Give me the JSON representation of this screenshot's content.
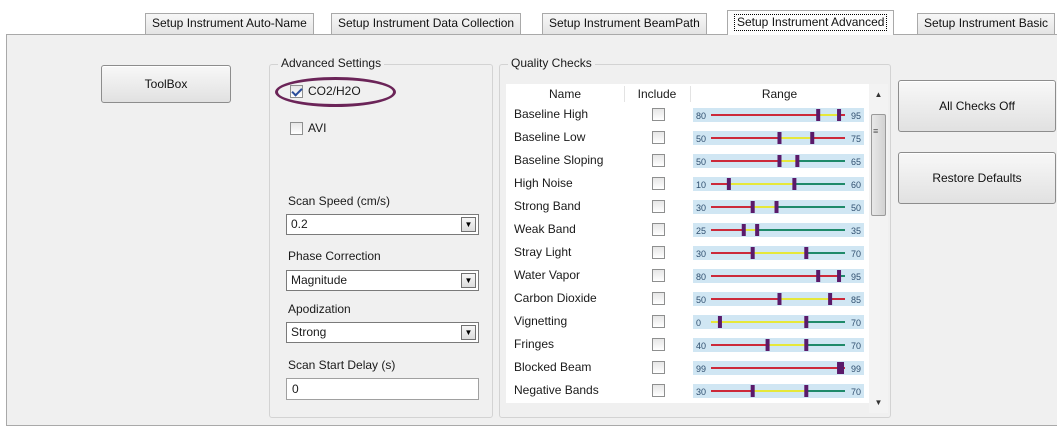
{
  "tabs": [
    {
      "label": "Setup Instrument Auto-Name",
      "active": false
    },
    {
      "label": "Setup Instrument Data Collection",
      "active": false
    },
    {
      "label": "Setup Instrument BeamPath",
      "active": false
    },
    {
      "label": "Setup Instrument Advanced",
      "active": true
    },
    {
      "label": "Setup Instrument Basic",
      "active": false
    }
  ],
  "toolbox_button": "ToolBox",
  "advanced": {
    "title": "Advanced Settings",
    "co2_h2o": {
      "label": "CO2/H2O",
      "checked": true
    },
    "avi": {
      "label": "AVI",
      "checked": false
    },
    "scan_speed_label": "Scan Speed (cm/s)",
    "scan_speed_value": "0.2",
    "phase_correction_label": "Phase Correction",
    "phase_correction_value": "Magnitude",
    "apodization_label": "Apodization",
    "apodization_value": "Strong",
    "scan_start_delay_label": "Scan Start Delay (s)",
    "scan_start_delay_value": "0"
  },
  "quality": {
    "title": "Quality Checks",
    "columns": {
      "name": "Name",
      "include": "Include",
      "range": "Range"
    },
    "rows": [
      {
        "name": "Baseline High",
        "include": false,
        "min": "80",
        "max": "95",
        "lo": 0.72,
        "hi": 0.86,
        "scheme": "ryr"
      },
      {
        "name": "Baseline Low",
        "include": false,
        "min": "50",
        "max": "75",
        "lo": 0.46,
        "hi": 0.68,
        "scheme": "ryr"
      },
      {
        "name": "Baseline Sloping",
        "include": false,
        "min": "50",
        "max": "65",
        "lo": 0.46,
        "hi": 0.58,
        "scheme": "ryg"
      },
      {
        "name": "High Noise",
        "include": false,
        "min": "10",
        "max": "60",
        "lo": 0.12,
        "hi": 0.56,
        "scheme": "ryg"
      },
      {
        "name": "Strong Band",
        "include": false,
        "min": "30",
        "max": "50",
        "lo": 0.28,
        "hi": 0.44,
        "scheme": "ryg"
      },
      {
        "name": "Weak Band",
        "include": false,
        "min": "25",
        "max": "35",
        "lo": 0.22,
        "hi": 0.31,
        "scheme": "ryg"
      },
      {
        "name": "Stray Light",
        "include": false,
        "min": "30",
        "max": "70",
        "lo": 0.28,
        "hi": 0.64,
        "scheme": "ryg"
      },
      {
        "name": "Water Vapor",
        "include": false,
        "min": "80",
        "max": "95",
        "lo": 0.72,
        "hi": 0.86,
        "scheme": "rrg"
      },
      {
        "name": "Carbon Dioxide",
        "include": false,
        "min": "50",
        "max": "85",
        "lo": 0.46,
        "hi": 0.8,
        "scheme": "ryr"
      },
      {
        "name": "Vignetting",
        "include": false,
        "min": "0",
        "max": "70",
        "lo": 0.06,
        "hi": 0.64,
        "scheme": "yyg"
      },
      {
        "name": "Fringes",
        "include": false,
        "min": "40",
        "max": "70",
        "lo": 0.38,
        "hi": 0.64,
        "scheme": "ryg"
      },
      {
        "name": "Blocked Beam",
        "include": false,
        "min": "99",
        "max": "99",
        "lo": 0.86,
        "hi": 0.88,
        "scheme": "rrr"
      },
      {
        "name": "Negative Bands",
        "include": false,
        "min": "30",
        "max": "70",
        "lo": 0.28,
        "hi": 0.64,
        "scheme": "ryg"
      }
    ]
  },
  "buttons": {
    "all_checks_off": "All Checks Off",
    "restore_defaults": "Restore Defaults"
  },
  "colors": {
    "red": "#cc2a3a",
    "yellow": "#e6e83a",
    "green": "#1f8a6a",
    "marker": "#5a1a6a",
    "ellipse": "#6b2458"
  }
}
